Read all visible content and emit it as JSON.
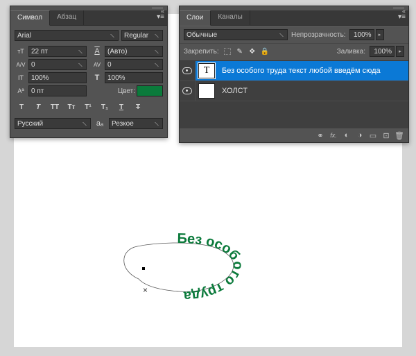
{
  "character_panel": {
    "tabs": {
      "symbol": "Символ",
      "paragraph": "Абзац"
    },
    "font_family": "Arial",
    "font_style": "Regular",
    "font_size_value": "22 пт",
    "leading_value": "(Авто)",
    "kerning_value": "0",
    "tracking_value": "0",
    "vscale_value": "100%",
    "hscale_value": "100%",
    "baseline_value": "0 пт",
    "color_label": "Цвет:",
    "color_hex": "#0b7a3b",
    "font_size_icon_text": "тТ",
    "leading_icon_text": "A",
    "kerning_icon_text": "A/V",
    "tracking_icon_text": "AV",
    "vscale_icon_text": "IT",
    "hscale_icon_text": "T",
    "baseline_icon_text": "Aª",
    "bold_glyph": "T",
    "italic_glyph": "T",
    "caps_glyph": "TT",
    "small_glyph": "Tт",
    "super_glyph": "T¹",
    "sub_glyph": "T₁",
    "underline_glyph": "T",
    "strike_glyph": "T",
    "aa_glyph": "aₐ",
    "lang_value": "Русский",
    "aa_value": "Резкое"
  },
  "layers_panel": {
    "tabs": {
      "layers": "Слои",
      "channels": "Каналы"
    },
    "blend_mode_value": "Обычные",
    "opacity_label": "Непрозрачность:",
    "opacity_value": "100%",
    "fill_label": "Заливка:",
    "fill_value": "100%",
    "lock_label": "Закрепить:",
    "layers": [
      {
        "type": "text",
        "name": "Без особого труда текст любой введём сюда",
        "selected": true,
        "visible": true
      },
      {
        "type": "pixel",
        "name": "ХОЛСТ",
        "selected": false,
        "visible": true
      }
    ],
    "text_thumb_glyph": "T"
  },
  "text_on_path": {
    "text": "Без особого труда",
    "color": "#0b7a3b"
  }
}
